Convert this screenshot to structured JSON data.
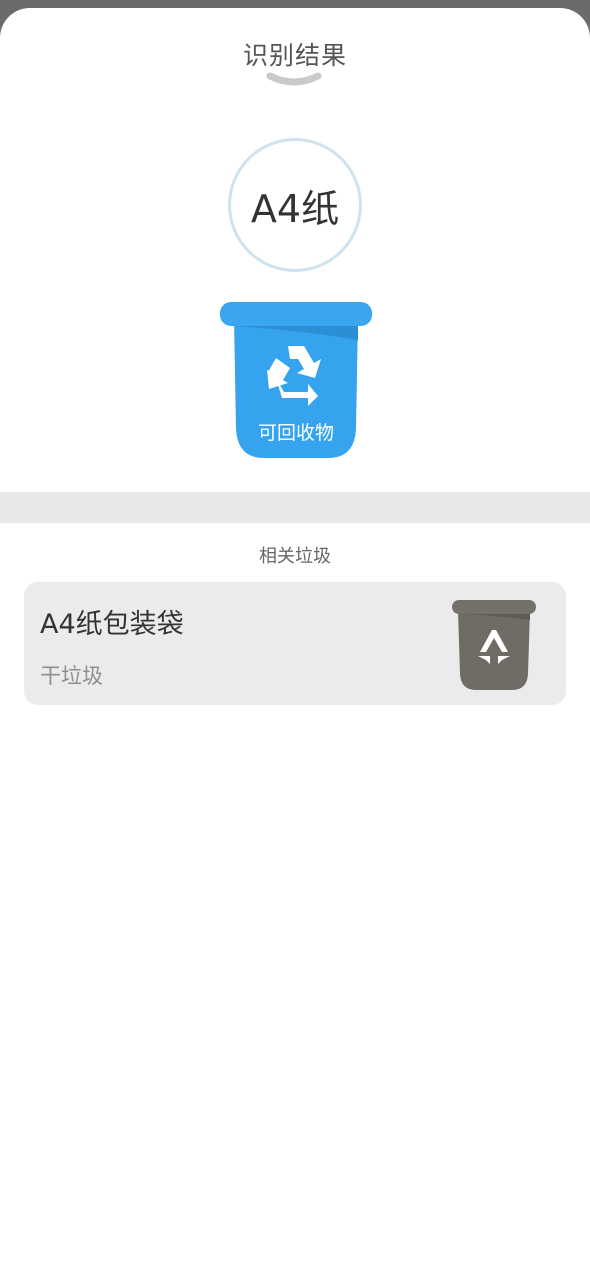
{
  "header": {
    "title": "识别结果"
  },
  "result": {
    "item_name": "A4纸",
    "category_label": "可回收物",
    "category_color": "#35a3ee",
    "category_icon": "recycle-icon"
  },
  "related": {
    "title": "相关垃圾",
    "items": [
      {
        "name": "A4纸包装袋",
        "category": "干垃圾",
        "bin_color": "#6f6c66",
        "icon": "dry-waste-icon"
      }
    ]
  }
}
